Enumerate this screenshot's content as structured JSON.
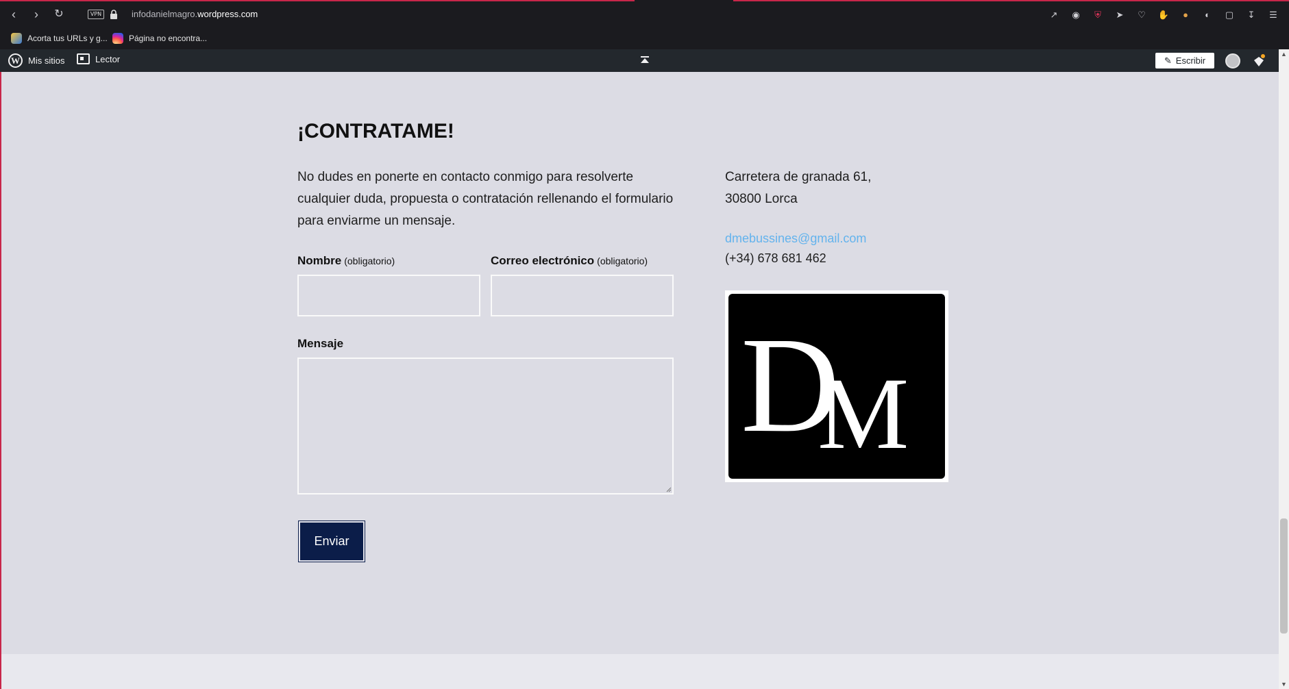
{
  "browser": {
    "url_prefix": "infodanielmagro.",
    "url_domain": "wordpress.com",
    "vpn_label": "VPN",
    "bookmarks": [
      {
        "label": "Acorta tus URLs y g..."
      },
      {
        "label": "Página no encontra..."
      }
    ]
  },
  "adminbar": {
    "my_sites": "Mis sitios",
    "reader": "Lector",
    "write": "Escribir"
  },
  "page": {
    "heading": "¡CONTRATAME!",
    "intro": "No dudes en ponerte en contacto conmigo para resolverte cualquier duda, propuesta o contratación rellenando el formulario para enviarme un mensaje.",
    "form": {
      "name_label": "Nombre",
      "name_required": "(obligatorio)",
      "email_label": "Correo electrónico",
      "email_required": "(obligatorio)",
      "message_label": "Mensaje",
      "submit": "Enviar"
    },
    "contact": {
      "address_line1": "Carretera de granada 61,",
      "address_line2": "30800 Lorca",
      "email": "dmebussines@gmail.com",
      "phone": "(+34) 678 681 462"
    },
    "logo_text": "DM"
  },
  "colors": {
    "accent": "#c8264a",
    "button_bg": "#0b1d49",
    "link": "#63b3ed",
    "page_bg": "#dcdce4"
  }
}
